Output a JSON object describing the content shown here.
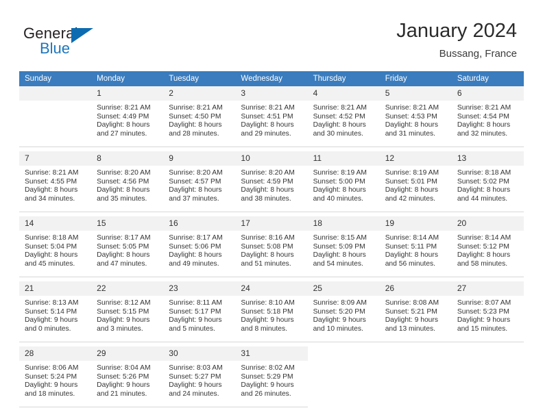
{
  "brand": {
    "name_part1": "General",
    "name_part2": "Blue",
    "accent_color": "#1b76bc",
    "flag_icon": "triangle-flag-icon"
  },
  "header": {
    "title": "January 2024",
    "location": "Bussang, France"
  },
  "calendar": {
    "header_bg": "#3a7cbe",
    "daynum_bg": "#f2f2f2",
    "weekdays": [
      "Sunday",
      "Monday",
      "Tuesday",
      "Wednesday",
      "Thursday",
      "Friday",
      "Saturday"
    ],
    "weeks": [
      [
        {
          "day": "",
          "empty": true
        },
        {
          "day": "1",
          "sunrise": "Sunrise: 8:21 AM",
          "sunset": "Sunset: 4:49 PM",
          "daylight1": "Daylight: 8 hours",
          "daylight2": "and 27 minutes."
        },
        {
          "day": "2",
          "sunrise": "Sunrise: 8:21 AM",
          "sunset": "Sunset: 4:50 PM",
          "daylight1": "Daylight: 8 hours",
          "daylight2": "and 28 minutes."
        },
        {
          "day": "3",
          "sunrise": "Sunrise: 8:21 AM",
          "sunset": "Sunset: 4:51 PM",
          "daylight1": "Daylight: 8 hours",
          "daylight2": "and 29 minutes."
        },
        {
          "day": "4",
          "sunrise": "Sunrise: 8:21 AM",
          "sunset": "Sunset: 4:52 PM",
          "daylight1": "Daylight: 8 hours",
          "daylight2": "and 30 minutes."
        },
        {
          "day": "5",
          "sunrise": "Sunrise: 8:21 AM",
          "sunset": "Sunset: 4:53 PM",
          "daylight1": "Daylight: 8 hours",
          "daylight2": "and 31 minutes."
        },
        {
          "day": "6",
          "sunrise": "Sunrise: 8:21 AM",
          "sunset": "Sunset: 4:54 PM",
          "daylight1": "Daylight: 8 hours",
          "daylight2": "and 32 minutes."
        }
      ],
      [
        {
          "day": "7",
          "sunrise": "Sunrise: 8:21 AM",
          "sunset": "Sunset: 4:55 PM",
          "daylight1": "Daylight: 8 hours",
          "daylight2": "and 34 minutes."
        },
        {
          "day": "8",
          "sunrise": "Sunrise: 8:20 AM",
          "sunset": "Sunset: 4:56 PM",
          "daylight1": "Daylight: 8 hours",
          "daylight2": "and 35 minutes."
        },
        {
          "day": "9",
          "sunrise": "Sunrise: 8:20 AM",
          "sunset": "Sunset: 4:57 PM",
          "daylight1": "Daylight: 8 hours",
          "daylight2": "and 37 minutes."
        },
        {
          "day": "10",
          "sunrise": "Sunrise: 8:20 AM",
          "sunset": "Sunset: 4:59 PM",
          "daylight1": "Daylight: 8 hours",
          "daylight2": "and 38 minutes."
        },
        {
          "day": "11",
          "sunrise": "Sunrise: 8:19 AM",
          "sunset": "Sunset: 5:00 PM",
          "daylight1": "Daylight: 8 hours",
          "daylight2": "and 40 minutes."
        },
        {
          "day": "12",
          "sunrise": "Sunrise: 8:19 AM",
          "sunset": "Sunset: 5:01 PM",
          "daylight1": "Daylight: 8 hours",
          "daylight2": "and 42 minutes."
        },
        {
          "day": "13",
          "sunrise": "Sunrise: 8:18 AM",
          "sunset": "Sunset: 5:02 PM",
          "daylight1": "Daylight: 8 hours",
          "daylight2": "and 44 minutes."
        }
      ],
      [
        {
          "day": "14",
          "sunrise": "Sunrise: 8:18 AM",
          "sunset": "Sunset: 5:04 PM",
          "daylight1": "Daylight: 8 hours",
          "daylight2": "and 45 minutes."
        },
        {
          "day": "15",
          "sunrise": "Sunrise: 8:17 AM",
          "sunset": "Sunset: 5:05 PM",
          "daylight1": "Daylight: 8 hours",
          "daylight2": "and 47 minutes."
        },
        {
          "day": "16",
          "sunrise": "Sunrise: 8:17 AM",
          "sunset": "Sunset: 5:06 PM",
          "daylight1": "Daylight: 8 hours",
          "daylight2": "and 49 minutes."
        },
        {
          "day": "17",
          "sunrise": "Sunrise: 8:16 AM",
          "sunset": "Sunset: 5:08 PM",
          "daylight1": "Daylight: 8 hours",
          "daylight2": "and 51 minutes."
        },
        {
          "day": "18",
          "sunrise": "Sunrise: 8:15 AM",
          "sunset": "Sunset: 5:09 PM",
          "daylight1": "Daylight: 8 hours",
          "daylight2": "and 54 minutes."
        },
        {
          "day": "19",
          "sunrise": "Sunrise: 8:14 AM",
          "sunset": "Sunset: 5:11 PM",
          "daylight1": "Daylight: 8 hours",
          "daylight2": "and 56 minutes."
        },
        {
          "day": "20",
          "sunrise": "Sunrise: 8:14 AM",
          "sunset": "Sunset: 5:12 PM",
          "daylight1": "Daylight: 8 hours",
          "daylight2": "and 58 minutes."
        }
      ],
      [
        {
          "day": "21",
          "sunrise": "Sunrise: 8:13 AM",
          "sunset": "Sunset: 5:14 PM",
          "daylight1": "Daylight: 9 hours",
          "daylight2": "and 0 minutes."
        },
        {
          "day": "22",
          "sunrise": "Sunrise: 8:12 AM",
          "sunset": "Sunset: 5:15 PM",
          "daylight1": "Daylight: 9 hours",
          "daylight2": "and 3 minutes."
        },
        {
          "day": "23",
          "sunrise": "Sunrise: 8:11 AM",
          "sunset": "Sunset: 5:17 PM",
          "daylight1": "Daylight: 9 hours",
          "daylight2": "and 5 minutes."
        },
        {
          "day": "24",
          "sunrise": "Sunrise: 8:10 AM",
          "sunset": "Sunset: 5:18 PM",
          "daylight1": "Daylight: 9 hours",
          "daylight2": "and 8 minutes."
        },
        {
          "day": "25",
          "sunrise": "Sunrise: 8:09 AM",
          "sunset": "Sunset: 5:20 PM",
          "daylight1": "Daylight: 9 hours",
          "daylight2": "and 10 minutes."
        },
        {
          "day": "26",
          "sunrise": "Sunrise: 8:08 AM",
          "sunset": "Sunset: 5:21 PM",
          "daylight1": "Daylight: 9 hours",
          "daylight2": "and 13 minutes."
        },
        {
          "day": "27",
          "sunrise": "Sunrise: 8:07 AM",
          "sunset": "Sunset: 5:23 PM",
          "daylight1": "Daylight: 9 hours",
          "daylight2": "and 15 minutes."
        }
      ],
      [
        {
          "day": "28",
          "sunrise": "Sunrise: 8:06 AM",
          "sunset": "Sunset: 5:24 PM",
          "daylight1": "Daylight: 9 hours",
          "daylight2": "and 18 minutes."
        },
        {
          "day": "29",
          "sunrise": "Sunrise: 8:04 AM",
          "sunset": "Sunset: 5:26 PM",
          "daylight1": "Daylight: 9 hours",
          "daylight2": "and 21 minutes."
        },
        {
          "day": "30",
          "sunrise": "Sunrise: 8:03 AM",
          "sunset": "Sunset: 5:27 PM",
          "daylight1": "Daylight: 9 hours",
          "daylight2": "and 24 minutes."
        },
        {
          "day": "31",
          "sunrise": "Sunrise: 8:02 AM",
          "sunset": "Sunset: 5:29 PM",
          "daylight1": "Daylight: 9 hours",
          "daylight2": "and 26 minutes."
        },
        {
          "day": "",
          "blank": true
        },
        {
          "day": "",
          "blank": true
        },
        {
          "day": "",
          "blank": true
        }
      ]
    ]
  }
}
